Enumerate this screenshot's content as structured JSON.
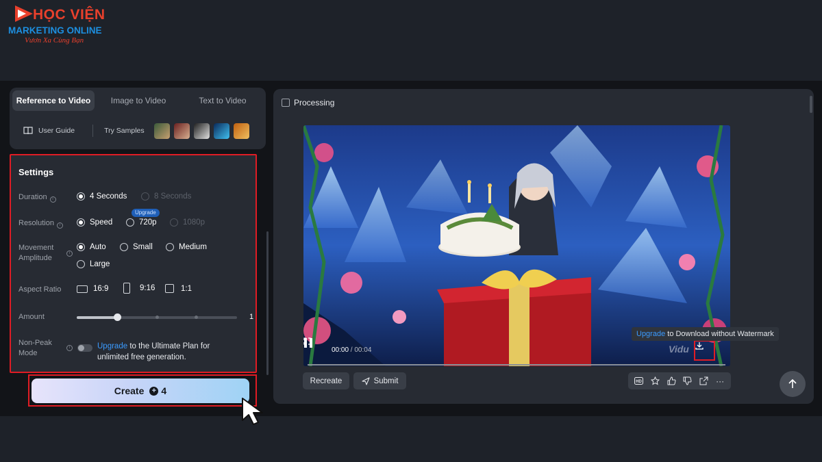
{
  "brand": {
    "title": "HỌC VIỆN",
    "subtitle": "MARKETING ONLINE",
    "tagline": "Vươn Xa Cùng Bạn"
  },
  "tabs": [
    {
      "label": "Reference to Video",
      "active": true
    },
    {
      "label": "Image to Video",
      "active": false
    },
    {
      "label": "Text to Video",
      "active": false
    }
  ],
  "guide": {
    "user_guide": "User Guide",
    "try_samples": "Try Samples",
    "sample_icon": "portrait-thumbnail"
  },
  "settings": {
    "title": "Settings",
    "duration": {
      "label": "Duration",
      "options": [
        "4 Seconds",
        "8 Seconds"
      ],
      "selected": "4 Seconds"
    },
    "resolution": {
      "label": "Resolution",
      "options": [
        "Speed",
        "720p",
        "1080p"
      ],
      "selected": "Speed",
      "badge": "Upgrade"
    },
    "movement": {
      "label": "Movement Amplitude",
      "options": [
        "Auto",
        "Small",
        "Medium",
        "Large"
      ],
      "selected": "Auto"
    },
    "aspect": {
      "label": "Aspect Ratio",
      "options": [
        "16:9",
        "9:16",
        "1:1"
      ]
    },
    "amount": {
      "label": "Amount",
      "value": "1",
      "fraction": 0.25
    },
    "nonpeak": {
      "label": "Non-Peak Mode",
      "link": "Upgrade",
      "text": " to the Ultimate Plan for unlimited free generation."
    }
  },
  "create": {
    "label": "Create",
    "cost": "4"
  },
  "right": {
    "processing": "Processing",
    "time_current": "00:00",
    "time_sep": " / ",
    "time_total": "00:04",
    "watermark": "Vidu",
    "tooltip_link": "Upgrade",
    "tooltip_text": " to Download without Watermark",
    "recreate": "Recreate",
    "submit": "Submit",
    "hd": "HD",
    "more": "···"
  },
  "colors": {
    "accent_red": "#e01c24",
    "link_blue": "#3b9bff",
    "panel": "#272b33"
  }
}
